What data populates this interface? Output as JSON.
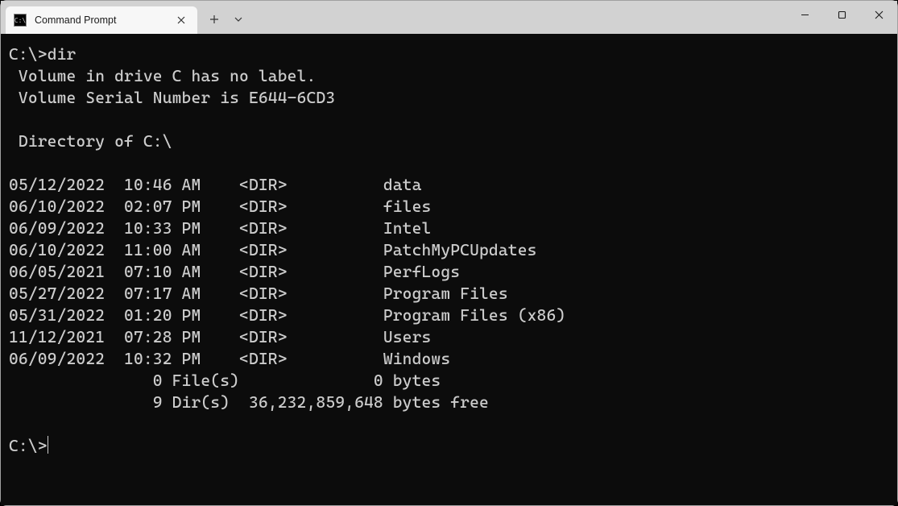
{
  "window": {
    "tab_title": "Command Prompt"
  },
  "terminal": {
    "prompt1": "C:\\>",
    "command1": "dir",
    "vol_line": " Volume in drive C has no label.",
    "serial_line": " Volume Serial Number is E644-6CD3",
    "dirof_line": " Directory of C:\\",
    "entries": [
      {
        "date": "05/12/2022",
        "time": "10:46 AM",
        "type": "<DIR>",
        "name": "data"
      },
      {
        "date": "06/10/2022",
        "time": "02:07 PM",
        "type": "<DIR>",
        "name": "files"
      },
      {
        "date": "06/09/2022",
        "time": "10:33 PM",
        "type": "<DIR>",
        "name": "Intel"
      },
      {
        "date": "06/10/2022",
        "time": "11:00 AM",
        "type": "<DIR>",
        "name": "PatchMyPCUpdates"
      },
      {
        "date": "06/05/2021",
        "time": "07:10 AM",
        "type": "<DIR>",
        "name": "PerfLogs"
      },
      {
        "date": "05/27/2022",
        "time": "07:17 AM",
        "type": "<DIR>",
        "name": "Program Files"
      },
      {
        "date": "05/31/2022",
        "time": "01:20 PM",
        "type": "<DIR>",
        "name": "Program Files (x86)"
      },
      {
        "date": "11/12/2021",
        "time": "07:28 PM",
        "type": "<DIR>",
        "name": "Users"
      },
      {
        "date": "06/09/2022",
        "time": "10:32 PM",
        "type": "<DIR>",
        "name": "Windows"
      }
    ],
    "summary_files": "               0 File(s)              0 bytes",
    "summary_dirs": "               9 Dir(s)  36,232,859,648 bytes free",
    "prompt2": "C:\\>"
  }
}
